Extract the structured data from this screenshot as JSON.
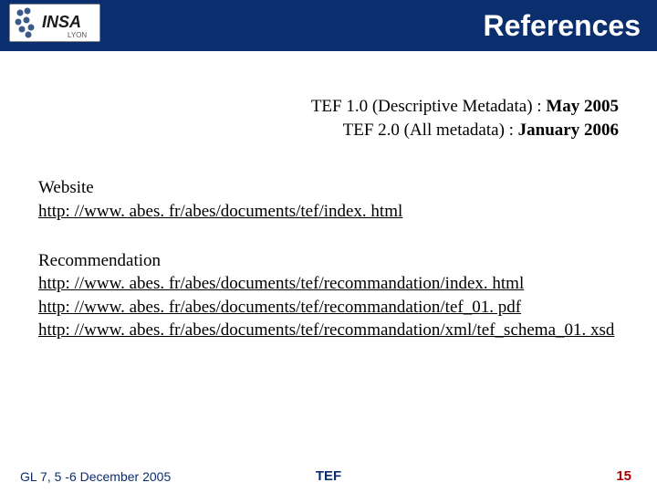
{
  "header": {
    "title": "References",
    "logo_text": "INSA"
  },
  "timeline": {
    "line1_prefix": "TEF 1.0 (Descriptive Metadata) : ",
    "line1_bold": "May 2005",
    "line2_prefix": "TEF 2.0 (All metadata) : ",
    "line2_bold": "January 2006"
  },
  "website": {
    "heading": "Website",
    "link": "http: //www. abes. fr/abes/documents/tef/index. html"
  },
  "recommendation": {
    "heading": "Recommendation",
    "links": [
      "http: //www. abes. fr/abes/documents/tef/recommandation/index. html",
      "http: //www. abes. fr/abes/documents/tef/recommandation/tef_01. pdf",
      "http: //www. abes. fr/abes/documents/tef/recommandation/xml/tef_schema_01. xsd"
    ]
  },
  "footer": {
    "left": "GL 7, 5 -6 December 2005",
    "center": "TEF",
    "page": "15"
  }
}
